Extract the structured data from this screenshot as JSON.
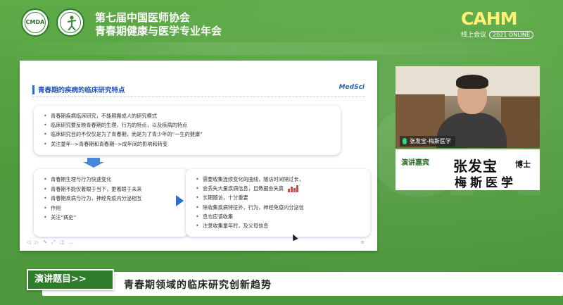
{
  "header": {
    "logo_left_text": "CMDA",
    "title_line1": "第七届中国医师协会",
    "title_line2": "青春期健康与医学专业年会",
    "brand_word": "CAHM",
    "brand_online": "线上会议",
    "brand_year": "2021 ONLINE"
  },
  "slide": {
    "title": "青春期的疾病的临床研究特点",
    "brand": "MedSci",
    "top_points": [
      "青春期疾病临床研究，不能照搬成人的研究模式",
      "临床研究要反映青春期的生理，行为的特点，以及疾病的特点",
      "临床研究目的不仅仅是为了青春期，而是为了青少年的“一生的健康”",
      "关注童年-->青春期和青春期-->成年间的影响和转变"
    ],
    "left_points": [
      "青春期生理与行为快速变化",
      "青春期不能仅着眼于当下，更着眼于未来",
      "青春期疾病与行为，神经免疫内分泌相互",
      "作用",
      "关注“病史”"
    ],
    "right_points": [
      "需要收集连续变化的曲线，随访时间隔过长，",
      "会丢失大量疾病信息，且数据会失真",
      "长期随访，十分重要",
      "除收集疾病特征外，行为，神经免疫内分泌信",
      "息也应该收集",
      "注意收集童年时，及父母信息"
    ],
    "toolbar": "◁ ▷ ✎ ⤢ ◫ …",
    "page_indicator": "≡"
  },
  "speaker": {
    "video_label": "张发宝-梅斯医学",
    "tag": "演讲嘉宾",
    "name": "张发宝",
    "title": "博士",
    "org": "梅斯医学"
  },
  "topic": {
    "label": "演讲题目>>",
    "text": "青春期领域的临床研究创新趋势"
  },
  "colors": {
    "background": "#5aa645",
    "accent_green": "#2f7d2a",
    "slide_blue": "#2c6fd1",
    "brand_yellow": "#fff176"
  }
}
